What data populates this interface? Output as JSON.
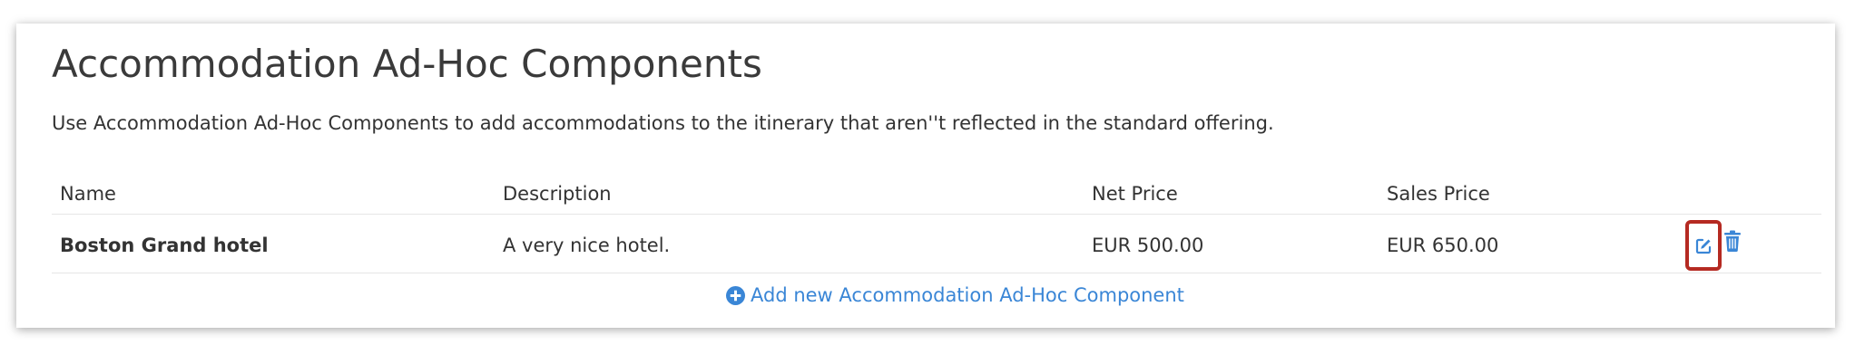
{
  "panel": {
    "title": "Accommodation Ad-Hoc Components",
    "description": "Use Accommodation Ad-Hoc Components to add accommodations to the itinerary that aren''t reflected in the standard offering."
  },
  "table": {
    "columns": [
      "Name",
      "Description",
      "Net Price",
      "Sales Price"
    ],
    "rows": [
      {
        "name": "Boston Grand hotel",
        "description": "A very nice hotel.",
        "net_price": "EUR 500.00",
        "sales_price": "EUR 650.00"
      }
    ],
    "actions": {
      "edit_icon": "edit-icon",
      "delete_icon": "trash-icon"
    }
  },
  "add_link": {
    "label": "Add new Accommodation Ad-Hoc Component",
    "icon": "plus-circle-icon"
  },
  "colors": {
    "accent": "#3a86d6",
    "highlight": "#b52a22"
  }
}
